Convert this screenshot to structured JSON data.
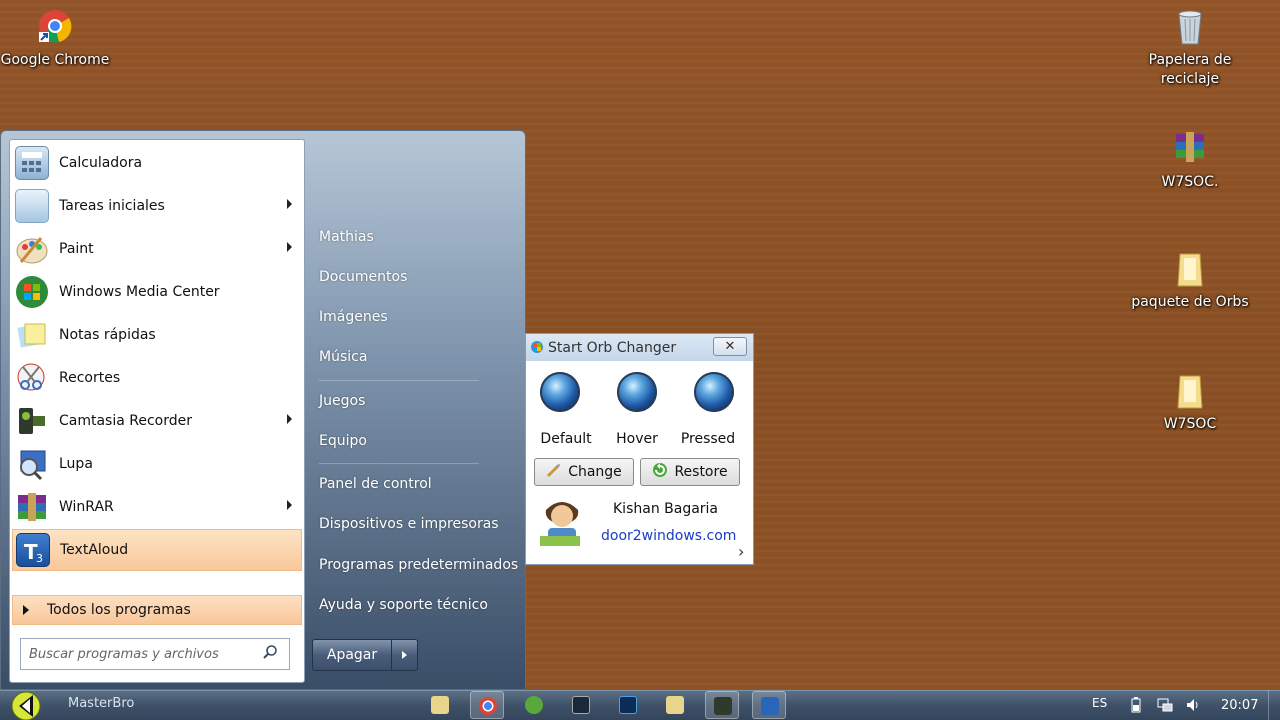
{
  "desktop": {
    "icons": [
      {
        "label": "Google Chrome",
        "icon": "chrome-icon"
      },
      {
        "label": "Papelera de reciclaje",
        "icon": "recycle-bin-icon"
      },
      {
        "label": "W7SOC.",
        "icon": "winrar-archive-icon"
      },
      {
        "label": "paquete de Orbs",
        "icon": "folder-icon"
      },
      {
        "label": "W7SOC",
        "icon": "folder-icon"
      }
    ]
  },
  "start_menu": {
    "programs": [
      {
        "label": "Calculadora",
        "icon": "calculator-icon",
        "submenu": false
      },
      {
        "label": "Tareas iniciales",
        "icon": "getting-started-icon",
        "submenu": true
      },
      {
        "label": "Paint",
        "icon": "paint-icon",
        "submenu": true
      },
      {
        "label": "Windows Media Center",
        "icon": "media-center-icon",
        "submenu": false
      },
      {
        "label": "Notas rápidas",
        "icon": "sticky-notes-icon",
        "submenu": false
      },
      {
        "label": "Recortes",
        "icon": "snipping-tool-icon",
        "submenu": false
      },
      {
        "label": "Camtasia Recorder",
        "icon": "camtasia-icon",
        "submenu": true
      },
      {
        "label": "Lupa",
        "icon": "magnifier-icon",
        "submenu": false
      },
      {
        "label": "WinRAR",
        "icon": "winrar-icon",
        "submenu": true
      },
      {
        "label": "TextAloud",
        "icon": "textaloud-icon",
        "submenu": false,
        "highlighted": true
      }
    ],
    "all_programs": "Todos los programas",
    "search_placeholder": "Buscar programas y archivos",
    "right_links": [
      "Mathias",
      "Documentos",
      "Imágenes",
      "Música",
      "Juegos",
      "Equipo",
      "Panel de control",
      "Dispositivos e impresoras",
      "Programas predeterminados",
      "Ayuda y soporte técnico"
    ],
    "shutdown_label": "Apagar"
  },
  "orb_changer": {
    "title": "Start Orb Changer",
    "close_label": "✕",
    "states": [
      "Default",
      "Hover",
      "Pressed"
    ],
    "change_label": "Change",
    "restore_label": "Restore",
    "author": "Kishan Bagaria",
    "website": "door2windows.com",
    "more_label": "›"
  },
  "taskbar": {
    "user": "MasterBro",
    "apps": [
      "explorer-icon",
      "chrome-icon",
      "utorrent-icon",
      "steam-icon",
      "photoshop-icon",
      "folder-icon",
      "camtasia-icon",
      "textaloud-icon"
    ],
    "language": "ES",
    "clock": "20:07"
  }
}
